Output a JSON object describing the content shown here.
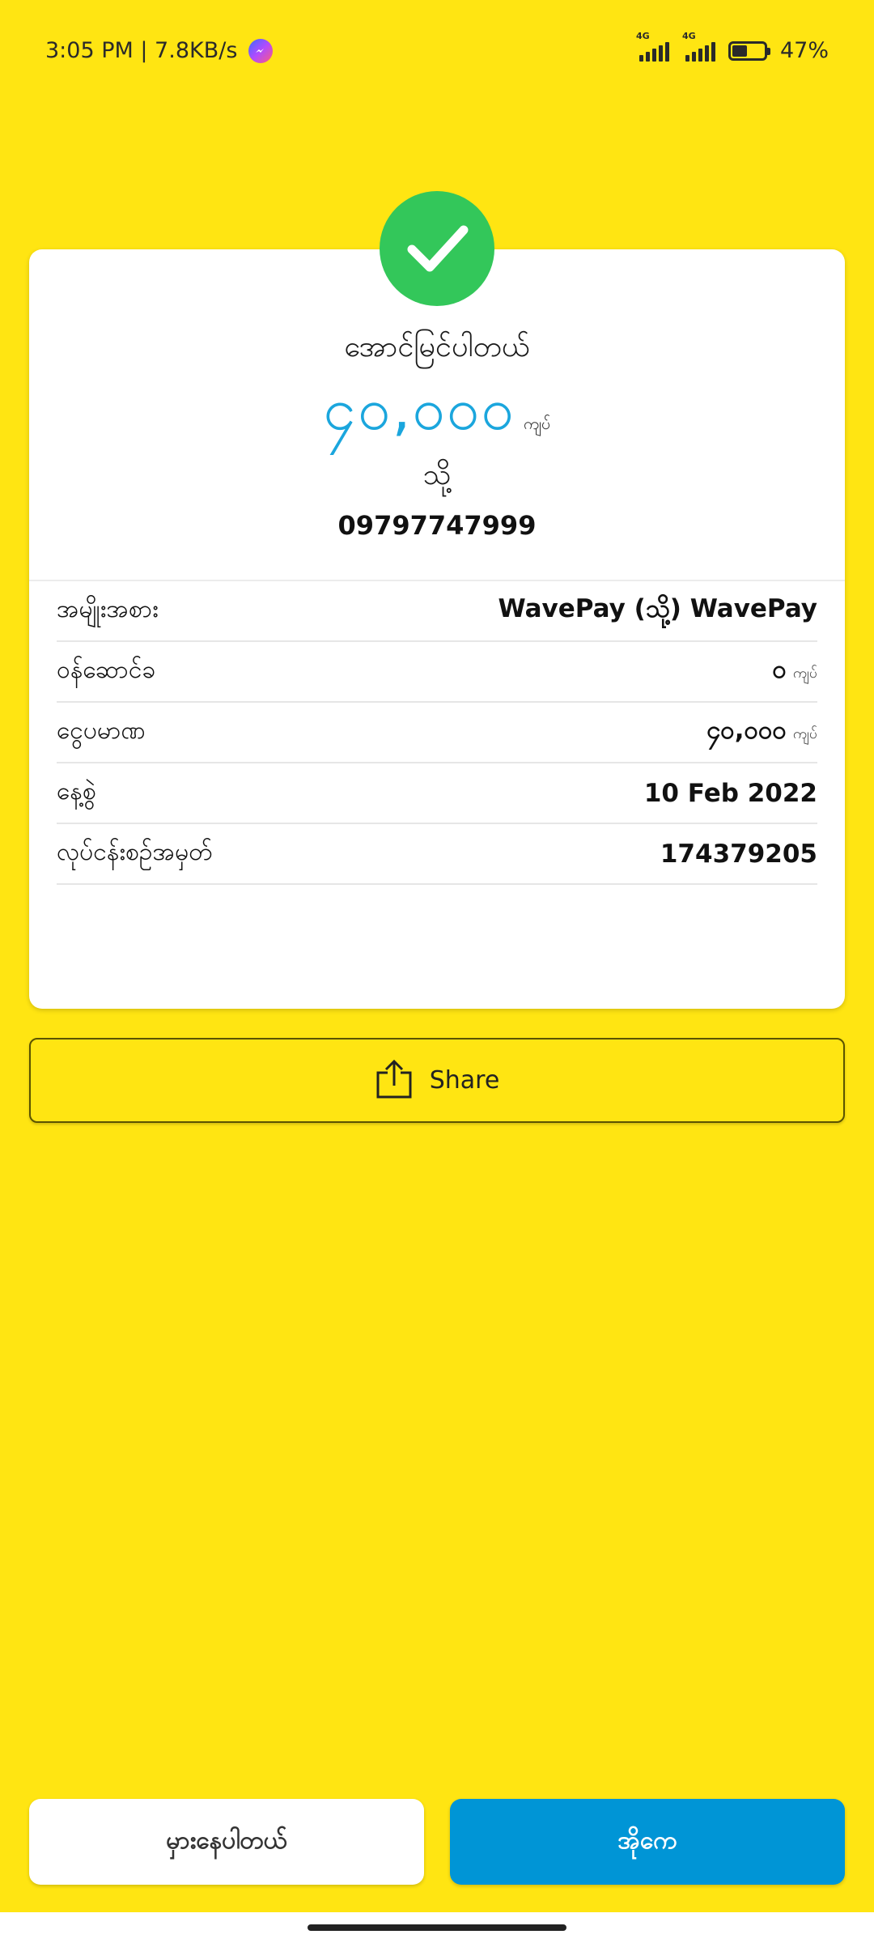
{
  "status_bar": {
    "time_speed": "3:05 PM | 7.8KB/s",
    "network_tag_1": "4G",
    "network_tag_2": "4G",
    "battery_percent": "47%",
    "battery_level": 0.47
  },
  "receipt": {
    "success_text": "အောင်မြင်ပါတယ်",
    "amount": "၄၀,၀၀၀",
    "amount_unit": "ကျပ်",
    "to_label": "သို့",
    "phone_number": "09797747999",
    "details": [
      {
        "label": "အမျိုးအစား",
        "value": "WavePay (သို့) WavePay",
        "unit": ""
      },
      {
        "label": "ဝန်ဆောင်ခ",
        "value": "၀",
        "unit": "ကျပ်"
      },
      {
        "label": "ငွေပမာဏ",
        "value": "၄၀,၀၀၀",
        "unit": "ကျပ်"
      },
      {
        "label": "နေ့စွဲ",
        "value": "10 Feb 2022",
        "unit": ""
      },
      {
        "label": "လုပ်ငန်းစဉ်အမှတ်",
        "value": "174379205",
        "unit": ""
      }
    ]
  },
  "share_button": {
    "label": "Share"
  },
  "buttons": {
    "report_label": "မှားနေပါတယ်",
    "ok_label": "အိုကေ"
  },
  "colors": {
    "background": "#FFE512",
    "accent_blue": "#0095D6",
    "amount_blue": "#1BA6DD",
    "success_green": "#33C75A"
  }
}
